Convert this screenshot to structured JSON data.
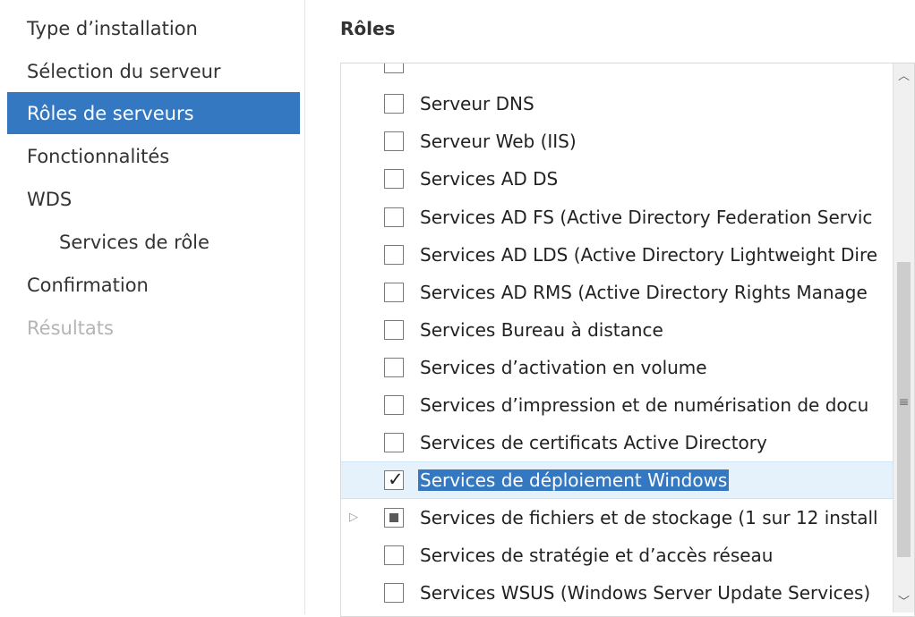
{
  "nav": {
    "items": [
      {
        "label": "Type d’installation",
        "state": "normal"
      },
      {
        "label": "Sélection du serveur",
        "state": "normal"
      },
      {
        "label": "Rôles de serveurs",
        "state": "active"
      },
      {
        "label": "Fonctionnalités",
        "state": "normal"
      },
      {
        "label": "WDS",
        "state": "normal"
      },
      {
        "label": "Services de rôle",
        "state": "sub"
      },
      {
        "label": "Confirmation",
        "state": "normal"
      },
      {
        "label": "Résultats",
        "state": "disabled"
      }
    ]
  },
  "content": {
    "heading": "Rôles",
    "roles": [
      {
        "label": "",
        "checked": false,
        "clipped": true
      },
      {
        "label": "Serveur DNS",
        "checked": false
      },
      {
        "label": "Serveur Web (IIS)",
        "checked": false
      },
      {
        "label": "Services AD DS",
        "checked": false
      },
      {
        "label": "Services AD FS (Active Directory Federation Servic",
        "checked": false
      },
      {
        "label": "Services AD LDS (Active Directory Lightweight Dire",
        "checked": false
      },
      {
        "label": "Services AD RMS (Active Directory Rights Manage",
        "checked": false
      },
      {
        "label": "Services Bureau à distance",
        "checked": false
      },
      {
        "label": "Services d’activation en volume",
        "checked": false
      },
      {
        "label": "Services d’impression et de numérisation de docu",
        "checked": false
      },
      {
        "label": "Services de certificats Active Directory",
        "checked": false
      },
      {
        "label": "Services de déploiement Windows",
        "checked": true,
        "selected": true
      },
      {
        "label": "Services de fichiers et de stockage (1 sur 12 install",
        "checked": "partial",
        "expandable": true
      },
      {
        "label": "Services de stratégie et d’accès réseau",
        "checked": false
      },
      {
        "label": "Services WSUS (Windows Server Update Services)",
        "checked": false
      }
    ]
  },
  "scrollbar": {
    "up_icon": "chevron-up-icon",
    "down_icon": "chevron-down-icon",
    "grip_icon": "grip-icon"
  },
  "colors": {
    "accent": "#3478c1",
    "selected_row": "#e5f1fb",
    "disabled_text": "#b4b4b4"
  }
}
